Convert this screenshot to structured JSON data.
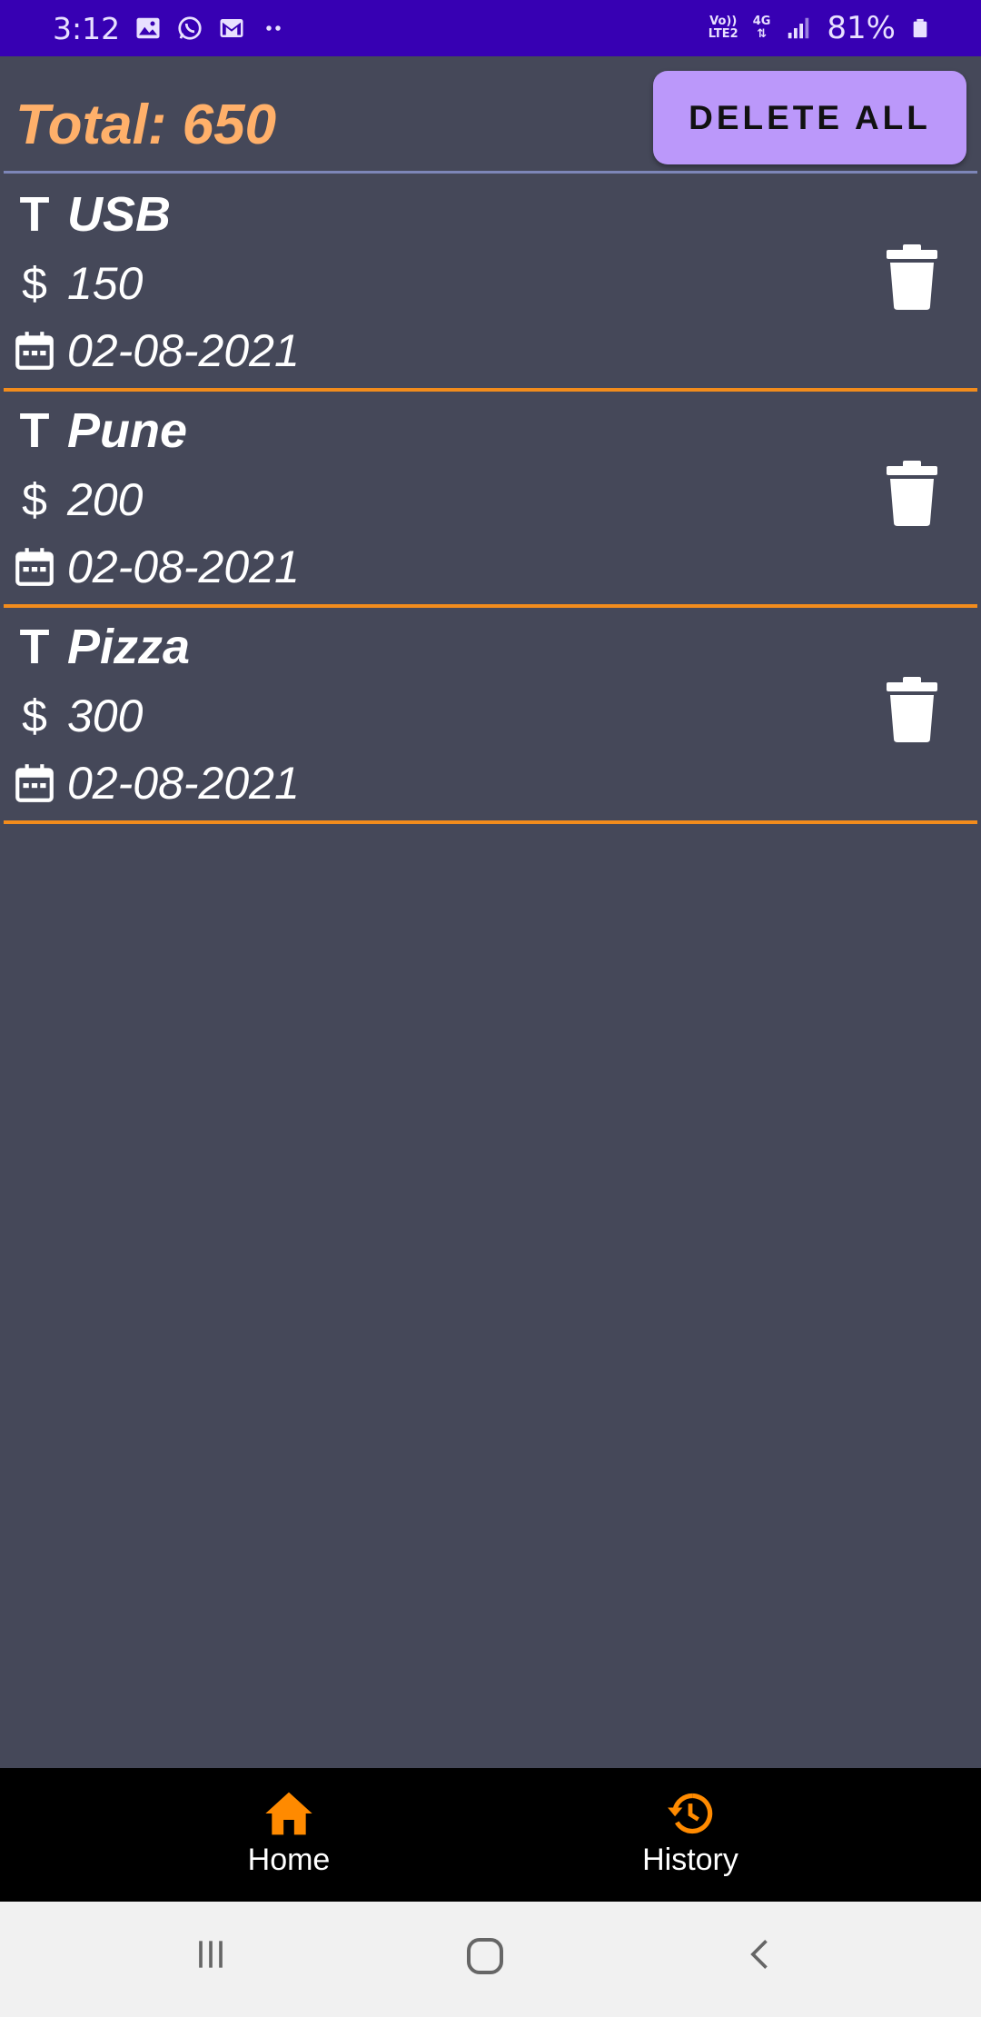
{
  "status_bar": {
    "time": "3:12",
    "left_icons": [
      "gallery-icon",
      "whatsapp-icon",
      "gmail-icon",
      "more-dots-icon"
    ],
    "network_top": "Vo))",
    "network_bottom": "LTE2",
    "network_type": "4G",
    "battery_percent": "81%",
    "background": "#3700b3"
  },
  "header": {
    "total_label": "Total: 650",
    "delete_all_label": "DELETE ALL",
    "accent": "#ffb06a",
    "button_color": "#bb98fa"
  },
  "expenses": [
    {
      "title": "USB",
      "amount": "150",
      "date": "02-08-2021"
    },
    {
      "title": "Pune",
      "amount": "200",
      "date": "02-08-2021"
    },
    {
      "title": "Pizza",
      "amount": "300",
      "date": "02-08-2021"
    }
  ],
  "item_icons": {
    "title": "text-t-icon",
    "amount": "dollar-icon",
    "date": "calendar-icon",
    "delete": "trash-icon"
  },
  "bottom_nav": {
    "items": [
      {
        "label": "Home",
        "icon": "home-icon",
        "active": true
      },
      {
        "label": "History",
        "icon": "history-icon",
        "active": false
      }
    ],
    "icon_color": "#ff8a00"
  },
  "system_nav": [
    "recent-apps-icon",
    "home-circle-icon",
    "back-icon"
  ],
  "colors": {
    "background": "#454859",
    "divider": "#f28c1c"
  }
}
